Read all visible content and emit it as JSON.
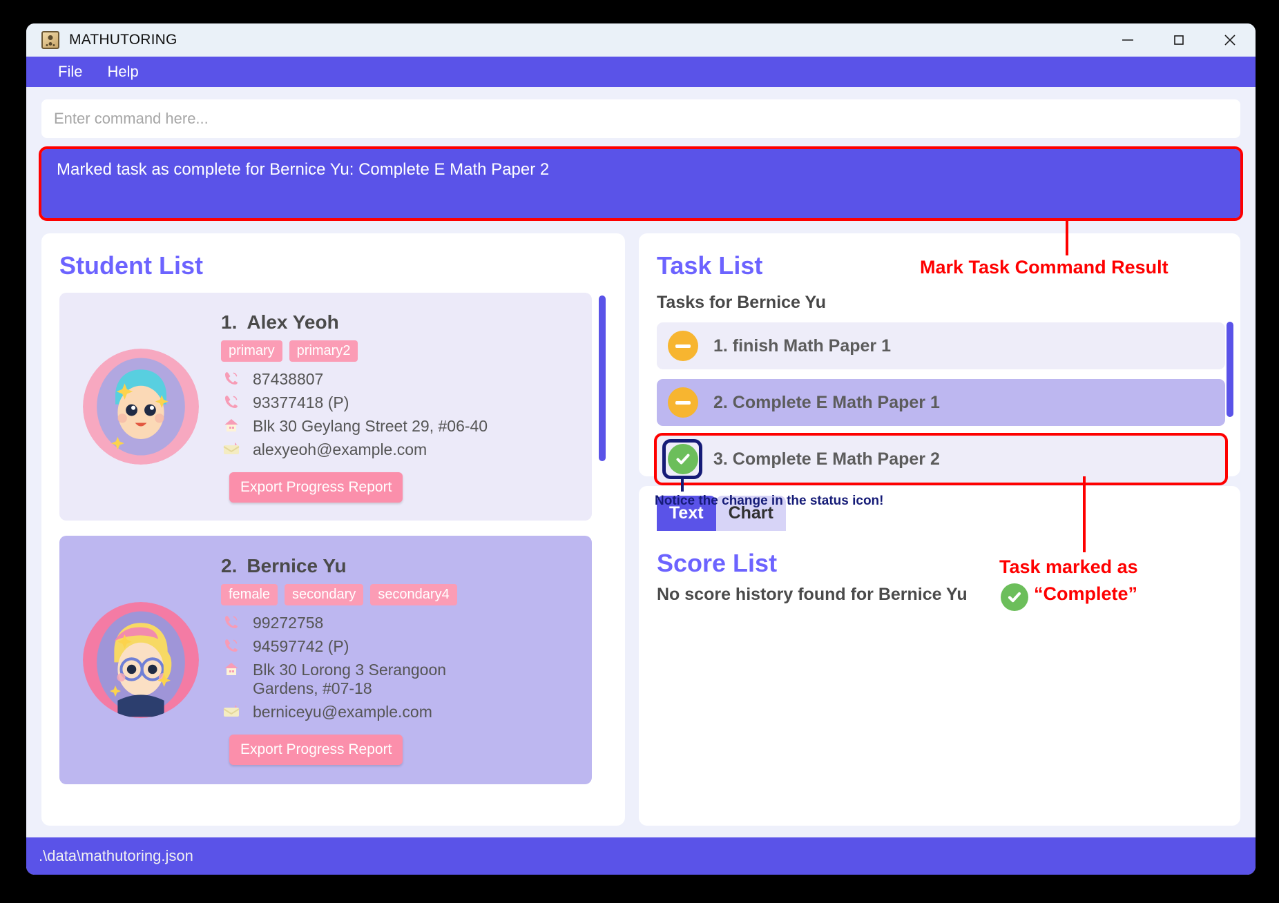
{
  "window": {
    "title": "MATHUTORING",
    "icon": "address-book-icon",
    "minimize": "minimize-icon",
    "maximize": "maximize-icon",
    "close": "close-icon"
  },
  "menubar": {
    "items": [
      "File",
      "Help"
    ]
  },
  "command": {
    "placeholder": "Enter command here...",
    "result": "Marked task as complete for Bernice Yu: Complete E Math Paper 2"
  },
  "student_panel": {
    "title": "Student List",
    "students": [
      {
        "index": "1.",
        "name": "Alex Yeoh",
        "tags": [
          "primary",
          "primary2"
        ],
        "phone": "87438807",
        "parent_phone": "93377418 (P)",
        "address": "Blk 30 Geylang Street 29, #06-40",
        "email": "alexyeoh@example.com",
        "export_label": "Export Progress Report"
      },
      {
        "index": "2.",
        "name": "Bernice Yu",
        "tags": [
          "female",
          "secondary",
          "secondary4"
        ],
        "phone": "99272758",
        "parent_phone": "94597742 (P)",
        "address": "Blk 30 Lorong 3 Serangoon Gardens, #07-18",
        "email": "berniceyu@example.com",
        "export_label": "Export Progress Report"
      }
    ]
  },
  "task_panel": {
    "title": "Task List",
    "subtitle": "Tasks for Bernice Yu",
    "tasks": [
      {
        "label": "1. finish Math Paper 1",
        "status": "pending"
      },
      {
        "label": "2. Complete E Math Paper 1",
        "status": "pending"
      },
      {
        "label": "3. Complete E Math Paper 2",
        "status": "complete"
      }
    ]
  },
  "score_panel": {
    "tabs": [
      "Text",
      "Chart"
    ],
    "active_tab": "Text",
    "title": "Score List",
    "empty_message": "No score history found for Bernice Yu"
  },
  "statusbar": {
    "path": ".\\data\\mathutoring.json"
  },
  "annotations": {
    "result_callout": "Mark Task Command Result",
    "status_icon_note": "Notice the change in the status icon!",
    "task_marked_line1": "Task marked as",
    "task_marked_line2": "“Complete”"
  },
  "colors": {
    "accent": "#5a53e8",
    "title_purple": "#6c63ff",
    "tag_pink": "#fb9cb5",
    "pending_amber": "#f7b530",
    "complete_green": "#6cbe5b",
    "annotation_red": "#fe0000",
    "annotation_navy": "#151b77"
  }
}
